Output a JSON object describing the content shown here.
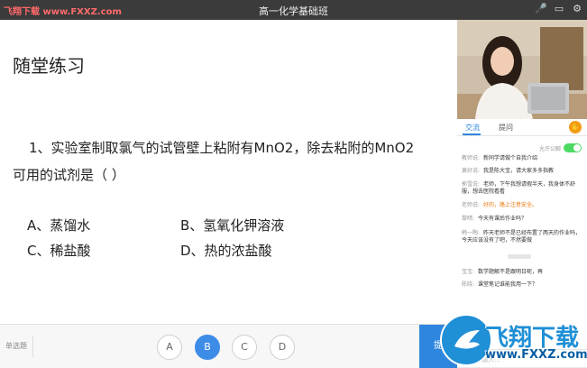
{
  "topbar": {
    "watermark": "飞翔下载 www.FXXZ.com",
    "title": "高一化学基础班",
    "icons": [
      "microphone-icon",
      "screen-icon",
      "settings-icon"
    ]
  },
  "slide": {
    "title": "随堂练习",
    "question_line1": "1、实验室制取氯气的试管壁上粘附有MnO2，除去粘附的MnO2",
    "question_line2": "可用的试剂是（         ）",
    "options": [
      "A、蒸馏水",
      "B、氢氧化钾溶液",
      "C、稀盐酸",
      "D、热的浓盐酸"
    ]
  },
  "answer_bar": {
    "question_type": "单选题",
    "choices": [
      "A",
      "B",
      "C",
      "D"
    ],
    "selected": "B",
    "submit_label": "提"
  },
  "side": {
    "tabs": [
      "交流",
      "提问"
    ],
    "toggle_label": "允许公聊",
    "messages": [
      {
        "name": "教师说:",
        "text": "新同学请做个自我介绍"
      },
      {
        "name": "黄好说:",
        "text": "我是陈大宝，请大家多多指教"
      },
      {
        "name": "郭雪说:",
        "text": "老师，下午我想请假半天，我身体不舒服，想去医院看看"
      },
      {
        "name": "老师说:",
        "text": "好的，路上注意安全。"
      },
      {
        "name": "黎晴:",
        "text": "今天有课后作业吗？"
      },
      {
        "name": "韩一陶:",
        "text": "昨天老师不是已经布置了两天的作业吗，今天应该没有了吧，不然要做"
      },
      {
        "name": "宝宝:",
        "text": "数学题解不是跟明日呢，再"
      },
      {
        "name": "陈晓:",
        "text": "课堂笔记谁能我用一下？"
      }
    ],
    "input_placeholder": "请在此输入..."
  },
  "logo": {
    "brand": "飞翔下载",
    "url": "www.FXXZ.com"
  },
  "colors": {
    "accent": "#2e86de",
    "topbar": "#3b3b3b",
    "warn": "#e8760c"
  }
}
